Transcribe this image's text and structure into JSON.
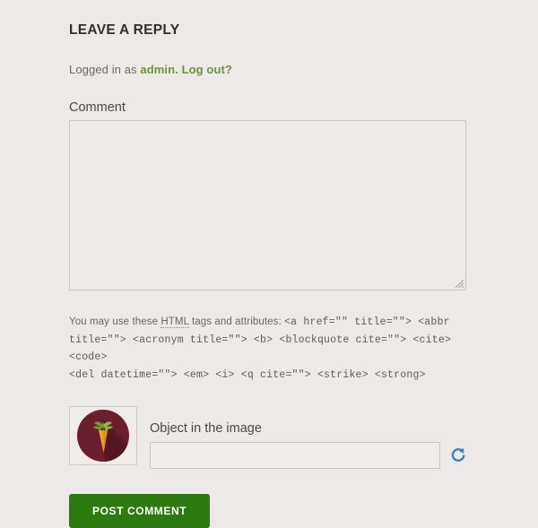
{
  "form": {
    "heading": "Leave a Reply",
    "logged_in": {
      "prefix": "Logged in as ",
      "user_link": "admin.",
      "logout_link": " Log out?"
    },
    "comment_label": "Comment",
    "comment_value": "",
    "comment_placeholder": ""
  },
  "html_help": {
    "lead_before": "You may use these ",
    "abbr": "HTML",
    "lead_after": " tags and attributes: ",
    "code_line_1": "<a href=\"\" title=\"\"> <abbr",
    "code_line_2": "title=\"\"> <acronym title=\"\"> <b> <blockquote cite=\"\"> <cite> <code>",
    "code_line_3": "<del datetime=\"\"> <em> <i> <q cite=\"\"> <strike> <strong>"
  },
  "captcha": {
    "label": "Object in the image",
    "input_value": "",
    "input_placeholder": "",
    "image_alt": "carrot-captcha-image",
    "reload_icon": "refresh-icon"
  },
  "submit": {
    "label": "Post Comment"
  },
  "colors": {
    "page_background": "#ece9e6",
    "link_green": "#6f9142",
    "button_green": "#2d7a10",
    "text_dark": "#3b3b38",
    "border_gray": "#c9c5c0",
    "captcha_circle": "#6b1f2e",
    "captcha_shadow": "#4d1620",
    "carrot_orange": "#f0a22e",
    "carrot_leaf_green": "#7ea53a"
  }
}
